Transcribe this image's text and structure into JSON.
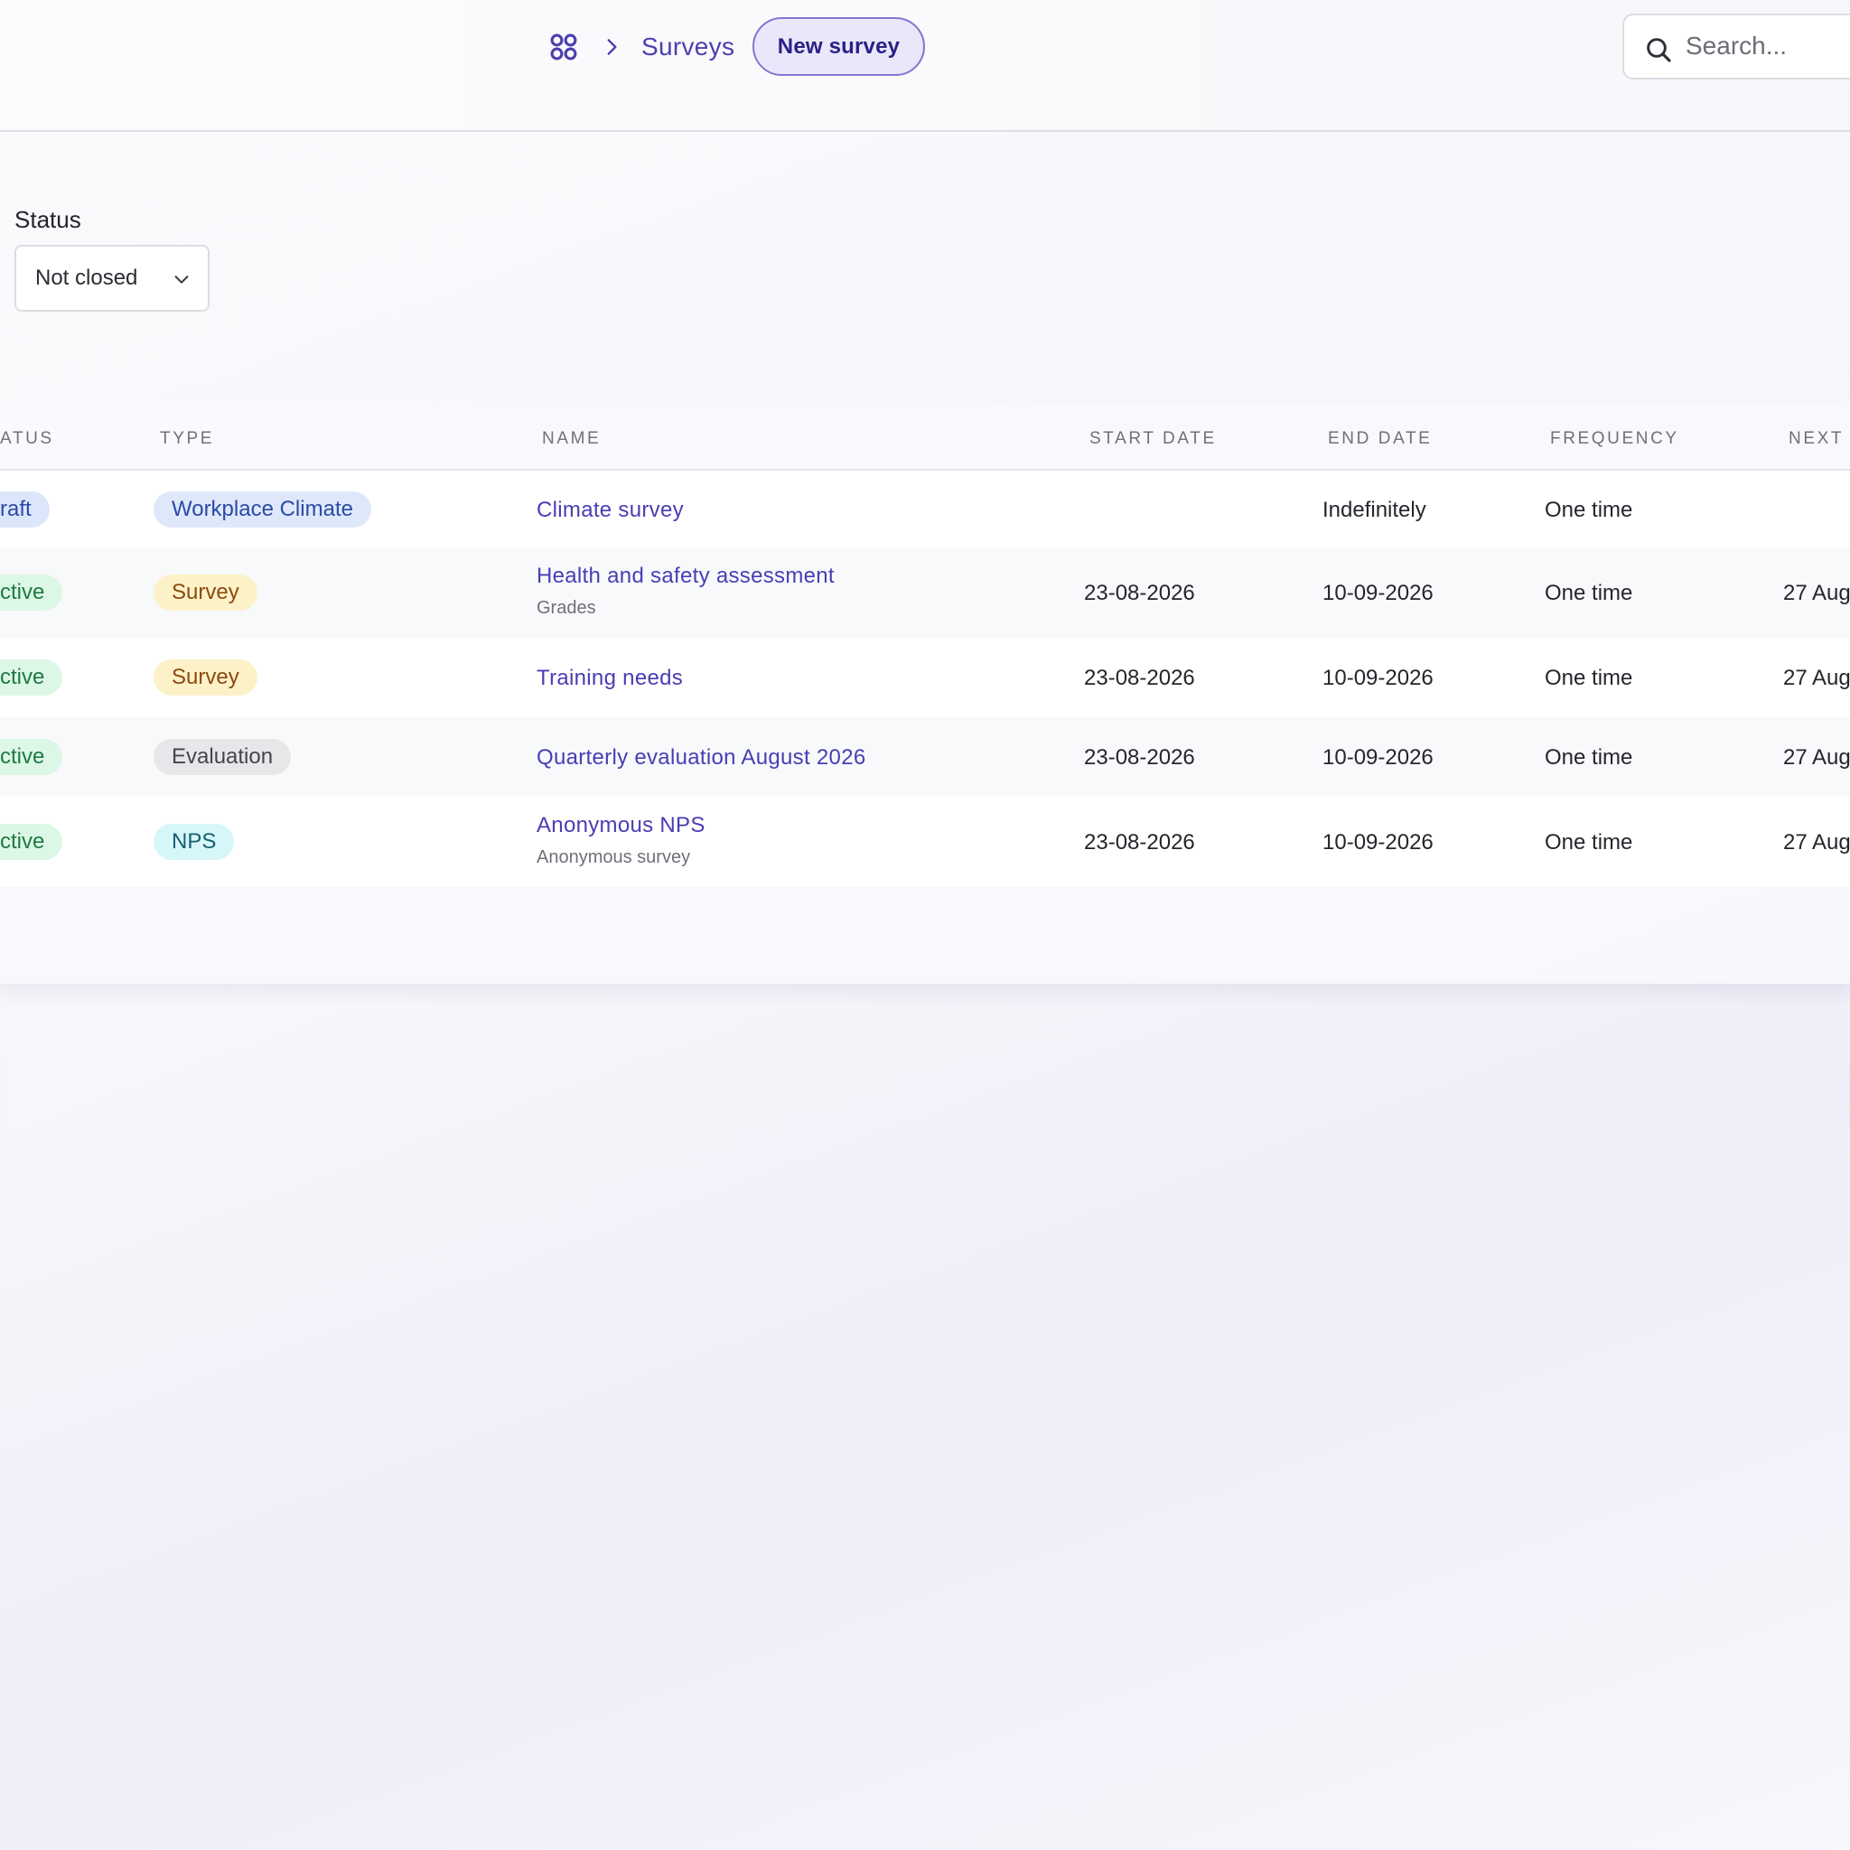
{
  "header": {
    "breadcrumb": {
      "current": "Surveys"
    },
    "new_survey_label": "New survey",
    "search_placeholder": "Search..."
  },
  "filter": {
    "label": "Status",
    "selected": "Not closed"
  },
  "table": {
    "columns": [
      "ATUS",
      "TYPE",
      "NAME",
      "START DATE",
      "END DATE",
      "FREQUENCY",
      "NEXT"
    ],
    "rows": [
      {
        "status": "raft",
        "type": "Workplace Climate",
        "name": "Climate survey",
        "subtitle": "",
        "start": "",
        "end": "Indefinitely",
        "frequency": "One time",
        "next": ""
      },
      {
        "status": "ctive",
        "type": "Survey",
        "name": "Health and safety assessment",
        "subtitle": "Grades",
        "start": "23-08-2026",
        "end": "10-09-2026",
        "frequency": "One time",
        "next": "27 Aug"
      },
      {
        "status": "ctive",
        "type": "Survey",
        "name": "Training needs",
        "subtitle": "",
        "start": "23-08-2026",
        "end": "10-09-2026",
        "frequency": "One time",
        "next": "27 Aug"
      },
      {
        "status": "ctive",
        "type": "Evaluation",
        "name": "Quarterly evaluation August 2026",
        "subtitle": "",
        "start": "23-08-2026",
        "end": "10-09-2026",
        "frequency": "One time",
        "next": "27 Aug"
      },
      {
        "status": "ctive",
        "type": "NPS",
        "name": "Anonymous NPS",
        "subtitle": "Anonymous survey",
        "start": "23-08-2026",
        "end": "10-09-2026",
        "frequency": "One time",
        "next": "27 Aug"
      }
    ]
  },
  "icons": {
    "home": "apps-grid-icon",
    "separator": "chevron-right-icon",
    "search": "search-icon",
    "dropdown": "chevron-down-icon"
  },
  "colors": {
    "accent": "#4a3db4",
    "button_bg": "#e9e7f9",
    "button_border": "#8077cf",
    "active_badge": "#dcf7e5",
    "draft_badge": "#dce6fb"
  }
}
